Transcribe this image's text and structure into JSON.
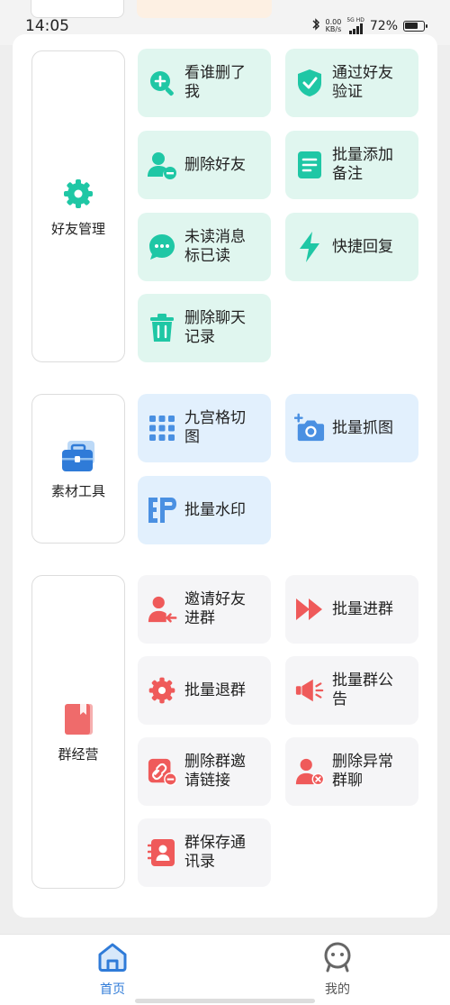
{
  "status_bar": {
    "time": "14:05",
    "net_speed_value": "0.00",
    "net_speed_unit": "KB/s",
    "network": "5G HD",
    "battery": "72%"
  },
  "categories": [
    {
      "label": "好友管理",
      "icon": "gear-icon",
      "tiles": [
        {
          "label": "看谁删了我",
          "icon": "search-add-icon"
        },
        {
          "label": "通过好友验证",
          "icon": "shield-check-icon"
        },
        {
          "label": "删除好友",
          "icon": "user-minus-icon"
        },
        {
          "label": "批量添加备注",
          "icon": "note-list-icon"
        },
        {
          "label": "未读消息标已读",
          "icon": "chat-bubble-icon"
        },
        {
          "label": "快捷回复",
          "icon": "lightning-icon"
        },
        {
          "label": "删除聊天记录",
          "icon": "trash-icon"
        }
      ]
    },
    {
      "label": "素材工具",
      "icon": "toolbox-icon",
      "tiles": [
        {
          "label": "九宫格切图",
          "icon": "grid-icon"
        },
        {
          "label": "批量抓图",
          "icon": "camera-add-icon"
        },
        {
          "label": "批量水印",
          "icon": "watermark-icon"
        }
      ]
    },
    {
      "label": "群经营",
      "icon": "book-icon",
      "tiles": [
        {
          "label": "邀请好友进群",
          "icon": "user-invite-icon"
        },
        {
          "label": "批量进群",
          "icon": "fast-forward-icon"
        },
        {
          "label": "批量退群",
          "icon": "gear-icon"
        },
        {
          "label": "批量群公告",
          "icon": "megaphone-icon"
        },
        {
          "label": "删除群邀请链接",
          "icon": "link-delete-icon"
        },
        {
          "label": "删除异常群聊",
          "icon": "user-remove-icon"
        },
        {
          "label": "群保存通讯录",
          "icon": "contacts-book-icon"
        }
      ]
    }
  ],
  "bottom_nav": [
    {
      "label": "首页",
      "icon": "home-icon",
      "active": true
    },
    {
      "label": "我的",
      "icon": "profile-face-icon",
      "active": false
    }
  ],
  "colors": {
    "accent": "#2f7bd8",
    "green_icon": "#1fc7a5",
    "red_icon": "#ef5a5a",
    "blue_icon": "#4a90e2"
  }
}
